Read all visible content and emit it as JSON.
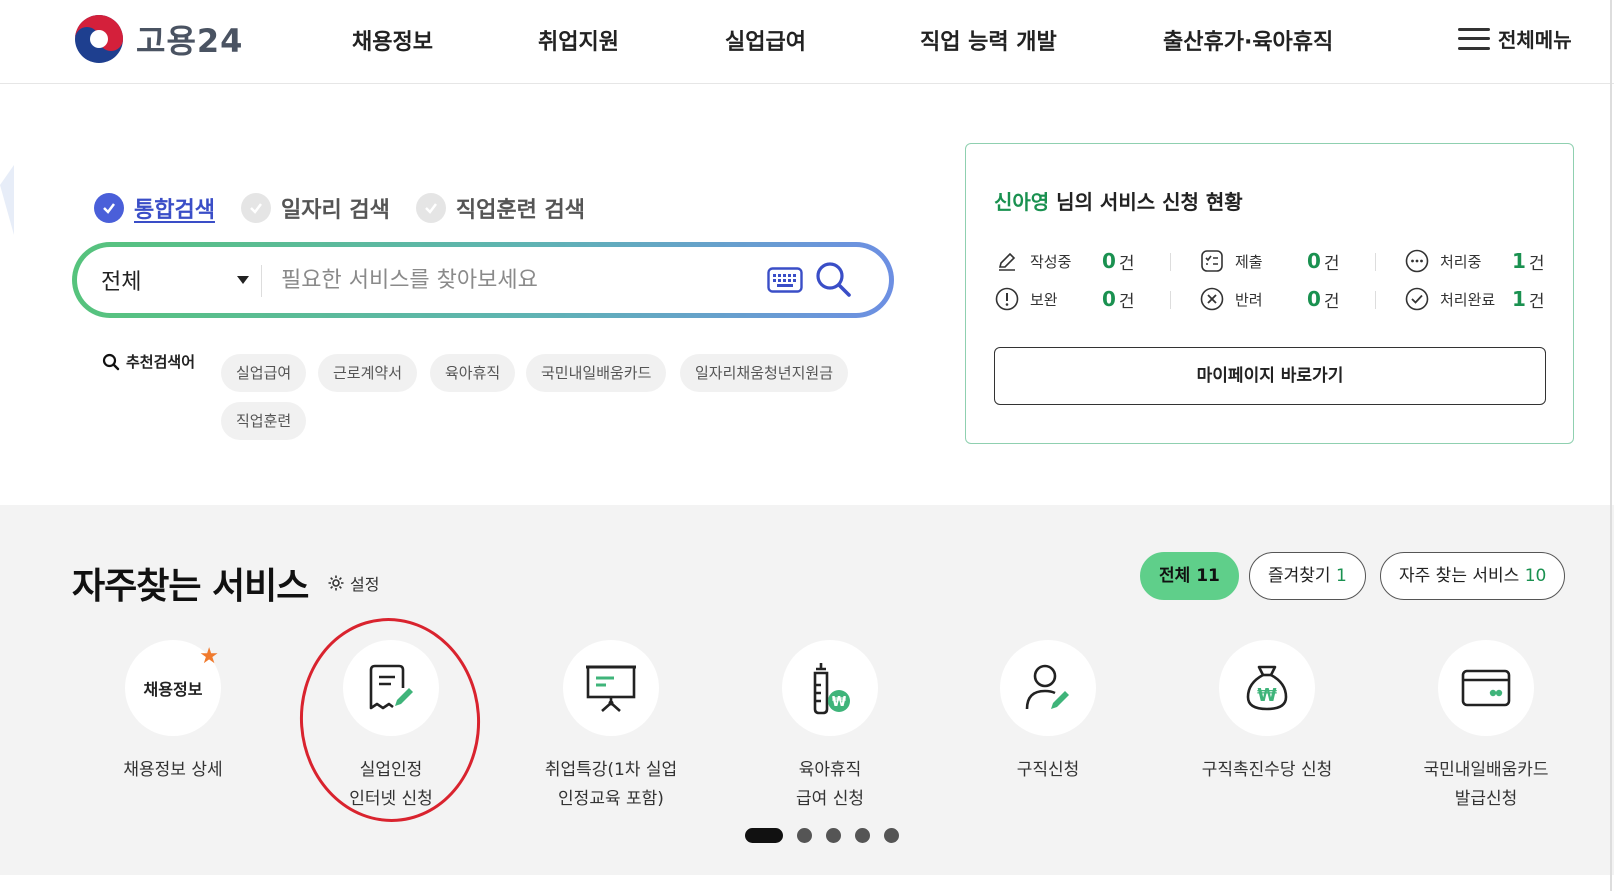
{
  "brand": {
    "logo_text": "고용24"
  },
  "nav": {
    "items": [
      "채용정보",
      "취업지원",
      "실업급여",
      "직업 능력 개발",
      "출산휴가·육아휴직"
    ],
    "all_menu_label": "전체메뉴"
  },
  "search": {
    "tabs": [
      {
        "label": "통합검색",
        "active": true
      },
      {
        "label": "일자리 검색",
        "active": false
      },
      {
        "label": "직업훈련 검색",
        "active": false
      }
    ],
    "category_selected": "전체",
    "placeholder": "필요한 서비스를 찾아보세요",
    "recommend_label": "추천검색어",
    "keywords": [
      "실업급여",
      "근로계약서",
      "육아휴직",
      "국민내일배움카드",
      "일자리채움청년지원금",
      "직업훈련"
    ]
  },
  "status": {
    "user_name": "신아영",
    "title_suffix": " 님의 서비스 신청 현황",
    "unit": "건",
    "items": [
      {
        "label": "작성중",
        "count": "0",
        "icon": "pencil-icon"
      },
      {
        "label": "제출",
        "count": "0",
        "icon": "checklist-icon"
      },
      {
        "label": "처리중",
        "count": "1",
        "icon": "ellipsis-circle-icon"
      },
      {
        "label": "보완",
        "count": "0",
        "icon": "exclamation-circle-icon"
      },
      {
        "label": "반려",
        "count": "0",
        "icon": "x-circle-icon"
      },
      {
        "label": "처리완료",
        "count": "1",
        "icon": "check-circle-icon"
      }
    ],
    "mypage_button": "마이페이지 바로가기"
  },
  "frequent": {
    "title": "자주찾는 서비스",
    "setting_label": "설정",
    "filters": [
      {
        "label": "전체",
        "count": "11",
        "active": true
      },
      {
        "label": "즐겨찾기",
        "count": "1",
        "active": false
      },
      {
        "label": "자주 찾는 서비스",
        "count": "10",
        "active": false
      }
    ],
    "services": [
      {
        "circle_text": "채용정보",
        "label_line1": "채용정보 상세",
        "label_line2": "",
        "icon": "text-badge",
        "favorite": true
      },
      {
        "circle_text": "",
        "label_line1": "실업인정",
        "label_line2": "인터넷 신청",
        "icon": "document-edit-icon",
        "favorite": false
      },
      {
        "circle_text": "",
        "label_line1": "취업특강(1차 실업",
        "label_line2": "인정교육 포함)",
        "icon": "presentation-board-icon",
        "favorite": false
      },
      {
        "circle_text": "",
        "label_line1": "육아휴직",
        "label_line2": "급여 신청",
        "icon": "baby-bottle-won-icon",
        "favorite": false
      },
      {
        "circle_text": "",
        "label_line1": "구직신청",
        "label_line2": "",
        "icon": "person-edit-icon",
        "favorite": false
      },
      {
        "circle_text": "",
        "label_line1": "구직촉진수당 신청",
        "label_line2": "",
        "icon": "money-bag-won-icon",
        "favorite": false
      },
      {
        "circle_text": "",
        "label_line1": "국민내일배움카드",
        "label_line2": "발급신청",
        "icon": "card-icon",
        "favorite": false
      }
    ],
    "pagination": {
      "total": 5,
      "current": 1
    }
  },
  "colors": {
    "accent_green": "#1a9150",
    "chip_active": "#5fcf8a",
    "search_blue": "#4a5fd9",
    "annotation_red": "#d9232e"
  }
}
